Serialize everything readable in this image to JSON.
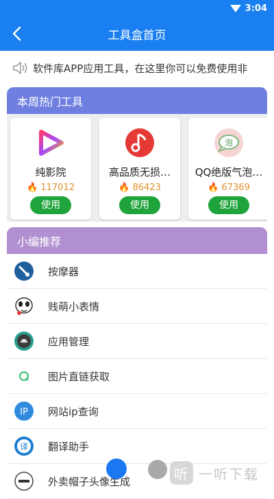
{
  "status": {
    "time": "3:04"
  },
  "header": {
    "title": "工具盒首页"
  },
  "notice": {
    "text": "软件库APP应用工具，在这里你可以免费使用非"
  },
  "hot": {
    "title": "本周热门工具",
    "use_label": "使用",
    "cards": [
      {
        "name": "纯影院",
        "count": "117012"
      },
      {
        "name": "高品质无损…",
        "count": "86423"
      },
      {
        "name": "QQ绝版气泡…",
        "count": "67369"
      }
    ]
  },
  "recommend": {
    "title": "小编推荐",
    "items": [
      {
        "label": "按摩器"
      },
      {
        "label": "贱萌小表情"
      },
      {
        "label": "应用管理"
      },
      {
        "label": "图片直链获取"
      },
      {
        "label": "网站ip查询"
      },
      {
        "label": "翻译助手"
      },
      {
        "label": "外卖帽子头像生成"
      }
    ]
  },
  "watermark": {
    "badge": "听",
    "text": "一听下载"
  }
}
